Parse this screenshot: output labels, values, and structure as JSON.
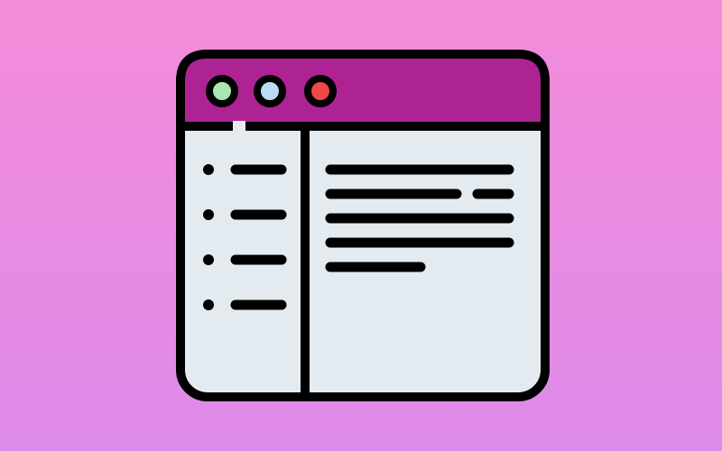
{
  "background": {
    "gradient_top": "#f48bd9",
    "gradient_bottom": "#de8bea"
  },
  "icon": {
    "name": "browser-window-icon",
    "outline_color": "#000000",
    "titlebar_color": "#ae2394",
    "window_body_color": "#e4ebf0",
    "dot_colors": {
      "green": "#a9e6b4",
      "blue": "#b9def4",
      "red": "#ee4949"
    },
    "sidebar_items": [
      "bullet-line",
      "bullet-line",
      "bullet-line",
      "bullet-line"
    ],
    "content_lines": 5
  }
}
